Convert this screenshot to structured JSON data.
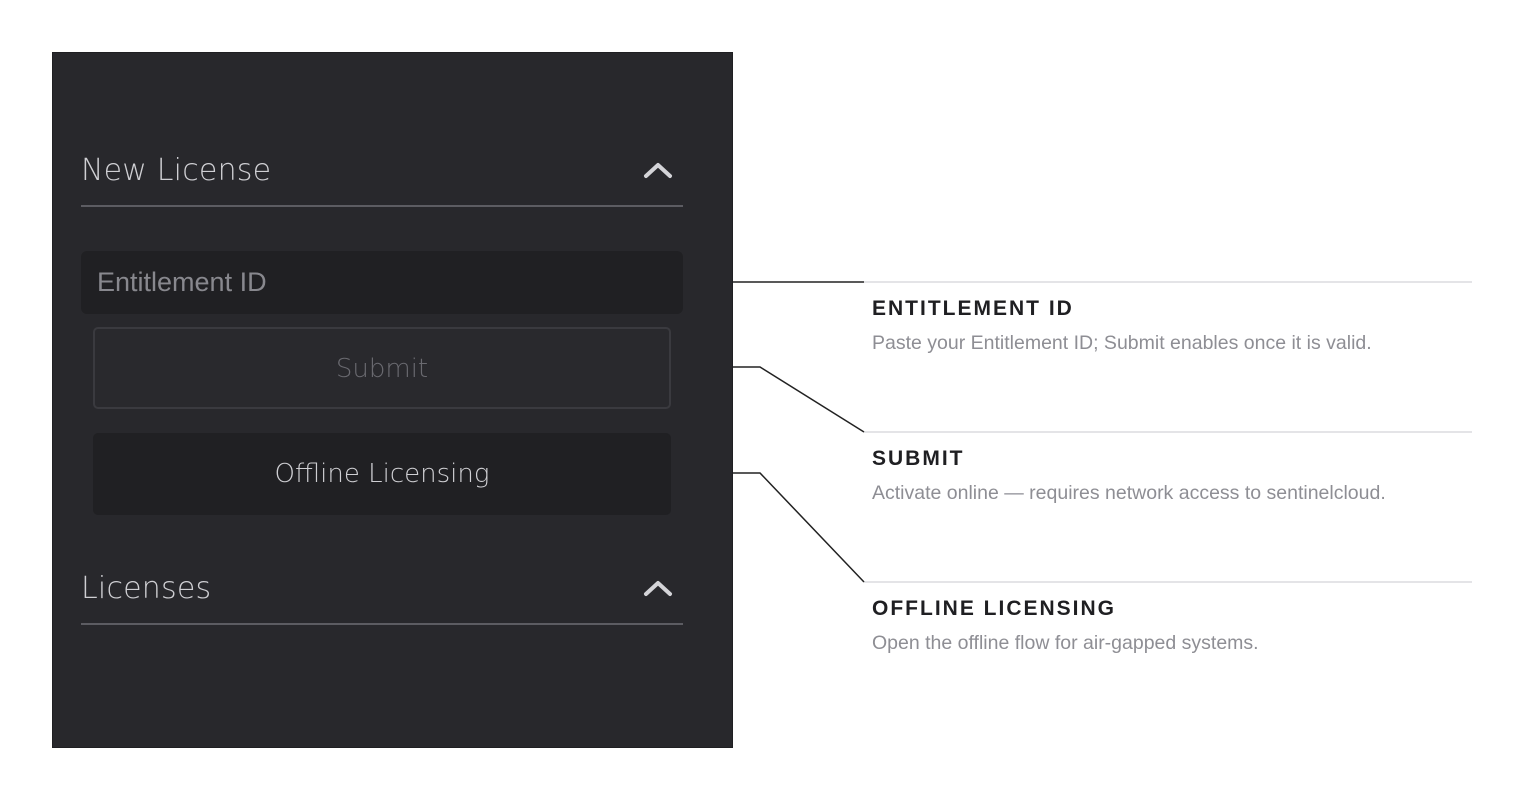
{
  "panel": {
    "new_license_title": "New License",
    "licenses_title": "Licenses",
    "entitlement_placeholder": "Entitlement ID",
    "entitlement_value": "",
    "submit_label": "Submit",
    "offline_label": "Offline Licensing",
    "icons": {
      "new_license_toggle": "chevron-up-icon",
      "licenses_toggle": "chevron-up-icon"
    }
  },
  "callouts": [
    {
      "title": "ENTITLEMENT ID",
      "description": "Paste your Entitlement ID; Submit enables once it is valid."
    },
    {
      "title": "SUBMIT",
      "description": "Activate online — requires network access to sentinelcloud."
    },
    {
      "title": "OFFLINE LICENSING",
      "description": "Open the offline flow for air-gapped systems."
    }
  ],
  "colors": {
    "panel_bg": "#28282c",
    "field_bg": "#202023",
    "text_light": "#cfcfd3",
    "text_disabled": "#6a6a70",
    "callout_title": "#1f1f22",
    "callout_desc": "#8e8e94",
    "connector": "#222222",
    "separator": "#dcdcdf"
  }
}
